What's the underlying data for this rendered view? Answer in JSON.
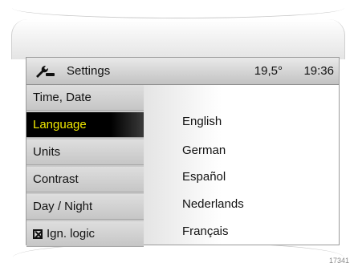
{
  "header": {
    "icon": "settings-wrench-icon",
    "title": "Settings",
    "temperature": "19,5°",
    "time": "19:36"
  },
  "menu": {
    "items": [
      {
        "label": "Time, Date",
        "selected": false
      },
      {
        "label": "Language",
        "selected": true
      },
      {
        "label": "Units",
        "selected": false
      },
      {
        "label": "Contrast",
        "selected": false
      },
      {
        "label": "Day / Night",
        "selected": false
      },
      {
        "label": "Ign. logic",
        "selected": false,
        "checkbox": true
      }
    ]
  },
  "languages": [
    "English",
    "German",
    "Español",
    "Nederlands",
    "Français"
  ],
  "image_code": "17341",
  "colors": {
    "selected_text": "#f0e800",
    "selected_bg": "#000000"
  }
}
